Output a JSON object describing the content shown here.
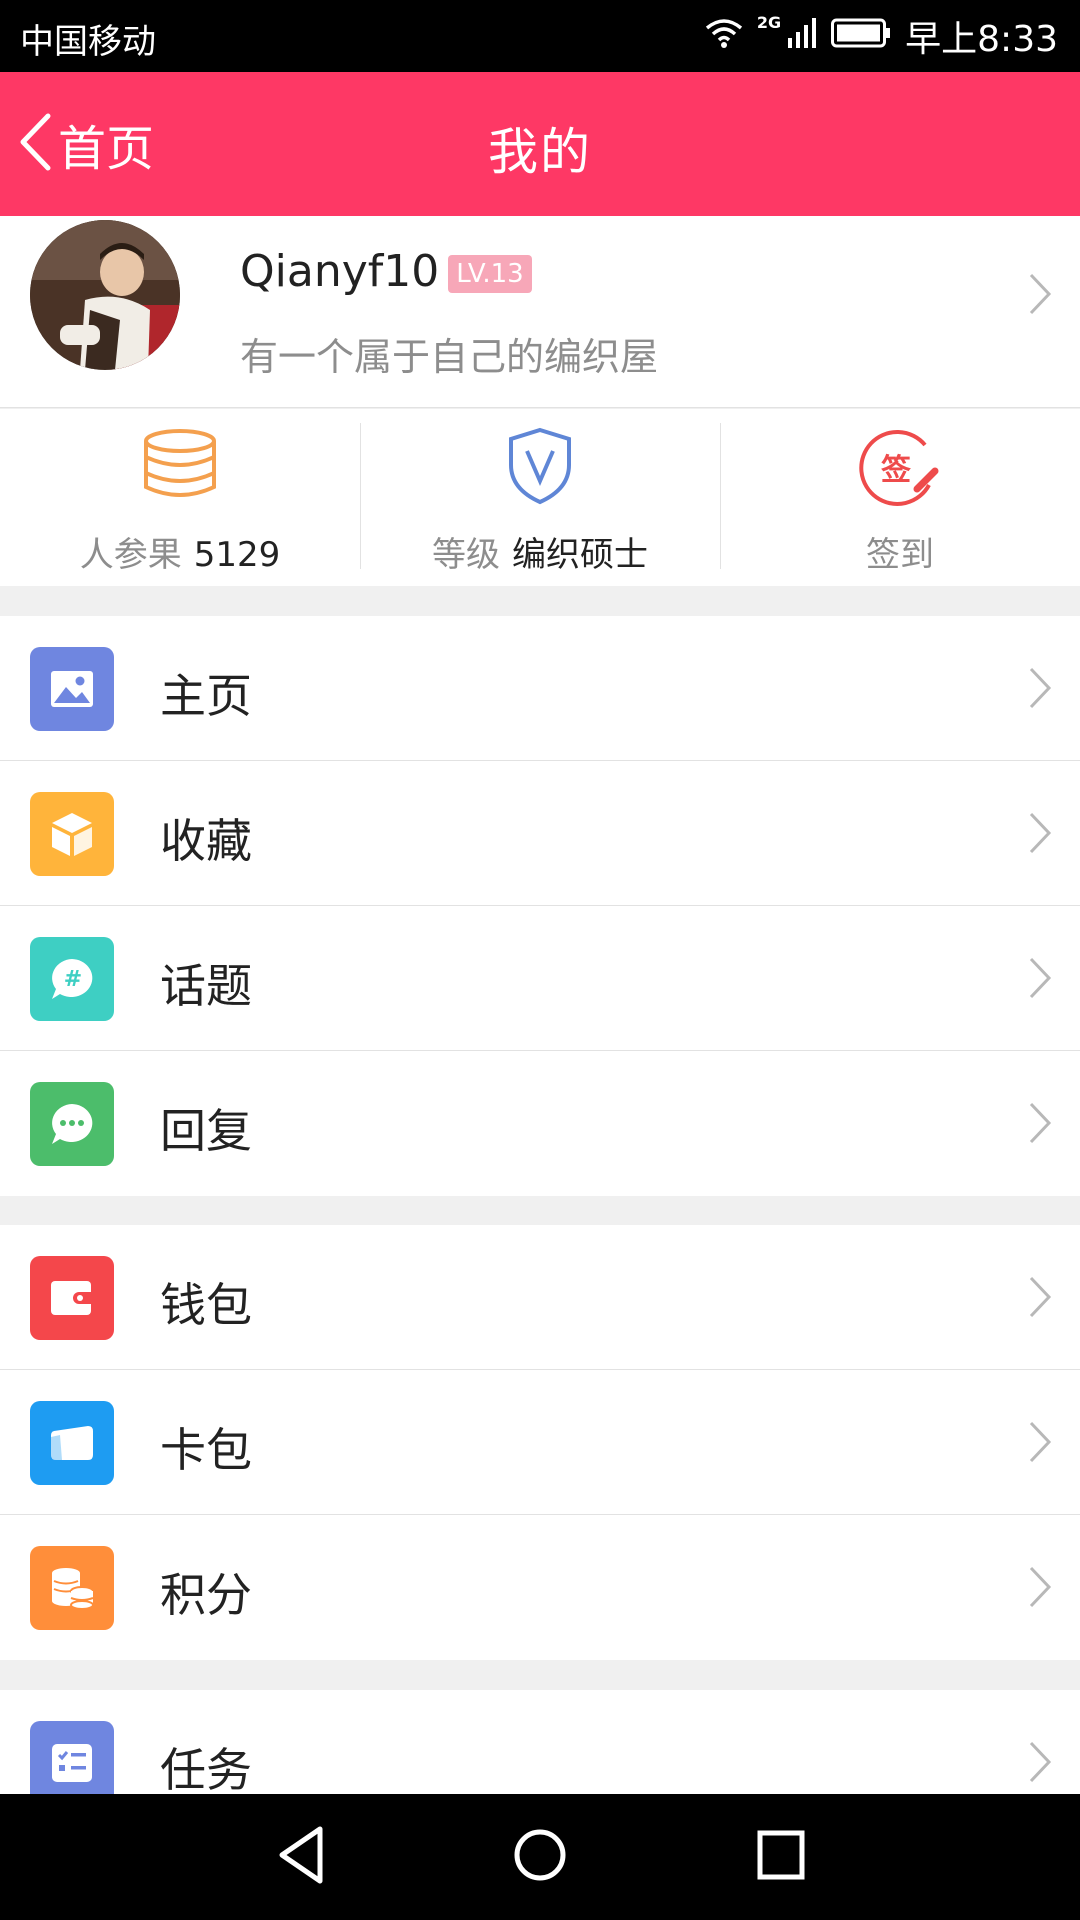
{
  "status_bar": {
    "carrier": "中国移动",
    "network": "2G",
    "time": "早上8:33"
  },
  "header": {
    "back_label": "首页",
    "title": "我的"
  },
  "profile": {
    "username": "Qianyf10",
    "level_badge": "LV.13",
    "signature": "有一个属于自己的编织屋"
  },
  "stats": [
    {
      "label": "人参果",
      "value": "5129",
      "icon": "coins-stack-icon"
    },
    {
      "label": "等级",
      "value": "编织硕士",
      "icon": "shield-v-icon"
    },
    {
      "label": "签到",
      "value": "",
      "icon": "sign-in-stamp-icon",
      "icon_text": "签"
    }
  ],
  "menu_groups": [
    [
      {
        "label": "主页",
        "icon": "image-icon",
        "color": "#6f86e0"
      },
      {
        "label": "收藏",
        "icon": "box-icon",
        "color": "#ffb43b"
      },
      {
        "label": "话题",
        "icon": "topic-hash-icon",
        "color": "#3ecfc3"
      },
      {
        "label": "回复",
        "icon": "chat-bubble-icon",
        "color": "#4cbd6b"
      }
    ],
    [
      {
        "label": "钱包",
        "icon": "wallet-icon",
        "color": "#f4474b"
      },
      {
        "label": "卡包",
        "icon": "card-icon",
        "color": "#1e9cf2"
      },
      {
        "label": "积分",
        "icon": "points-coins-icon",
        "color": "#ff8e3a"
      }
    ],
    [
      {
        "label": "任务",
        "icon": "task-list-icon",
        "color": "#6f86e0"
      }
    ]
  ],
  "colors": {
    "brand": "#fe3865",
    "badge": "#f7a7b8",
    "muted_text": "#8d8d8d",
    "divider": "#e2e2e2"
  }
}
